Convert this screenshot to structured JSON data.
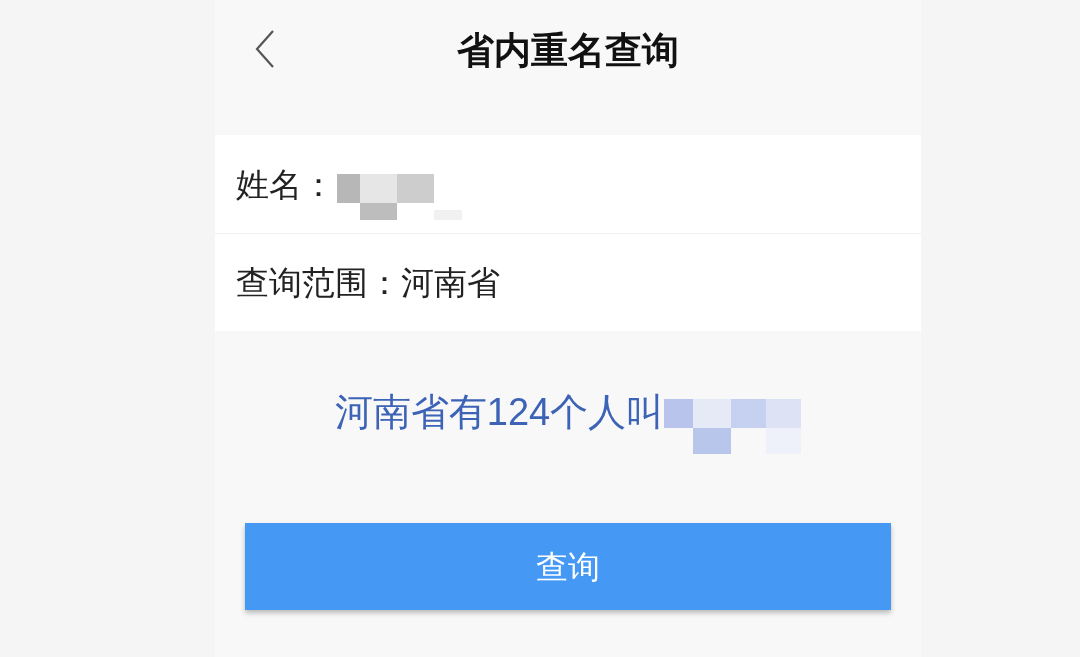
{
  "header": {
    "title": "省内重名查询"
  },
  "form": {
    "rows": [
      {
        "label": "姓名：",
        "value_redacted": true
      },
      {
        "label": "查询范围：",
        "value": "河南省",
        "value_redacted": false
      }
    ]
  },
  "result": {
    "text": "河南省有124个人叫",
    "name_redacted": true
  },
  "button": {
    "label": "查询"
  }
}
